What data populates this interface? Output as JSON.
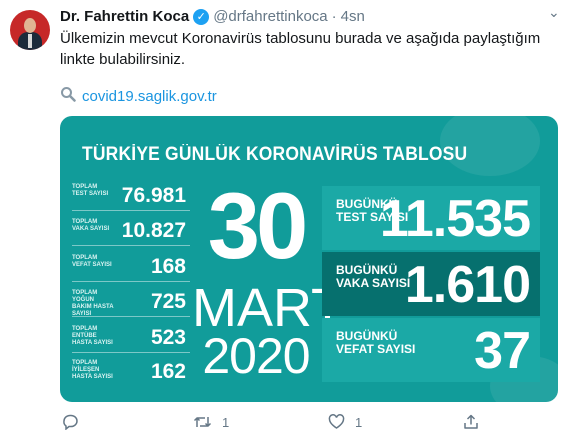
{
  "tweet": {
    "author_name": "Dr. Fahrettin Koca",
    "handle": "@drfahrettinkoca",
    "separator": "·",
    "time": "4sn",
    "text": "Ülkemizin mevcut Koronavirüs tablosunu burada ve aşağıda paylaştığım linkte bulabilirsiniz.",
    "link": "covid19.saglik.gov.tr",
    "icons": [
      "verified-badge-icon",
      "magnifier-icon",
      "reply-icon",
      "retweet-icon",
      "like-icon",
      "share-icon",
      "chevron-down-icon"
    ]
  },
  "card": {
    "title": "TÜRKİYE GÜNLÜK KORONAVİRÜS TABLOSU",
    "colors": {
      "background": "#119c9a",
      "box_light": "#1ba9a6",
      "box_dark": "#06706e"
    },
    "stats": [
      {
        "label": "TOPLAM TEST SAYISI",
        "value": "76.981"
      },
      {
        "label": "TOPLAM VAKA SAYISI",
        "value": "10.827"
      },
      {
        "label": "TOPLAM VEFAT SAYISI",
        "value": "168"
      },
      {
        "label": "TOPLAM YOĞUN BAKIM HASTA SAYISI",
        "value": "725"
      },
      {
        "label": "TOPLAM ENTÜBE HASTA SAYISI",
        "value": "523"
      },
      {
        "label": "TOPLAM İYİLEŞEN HASTA SAYISI",
        "value": "162"
      }
    ],
    "date_day": "30",
    "date_month": "MART",
    "date_year": "2020",
    "today": [
      {
        "label": "BUGÜNKÜ TEST SAYISI",
        "value": "11.535"
      },
      {
        "label": "BUGÜNKÜ VAKA SAYISI",
        "value": "1.610"
      },
      {
        "label": "BUGÜNKÜ VEFAT SAYISI",
        "value": "37"
      }
    ]
  },
  "actions": {
    "retweet_count": "1",
    "like_count": "1"
  }
}
